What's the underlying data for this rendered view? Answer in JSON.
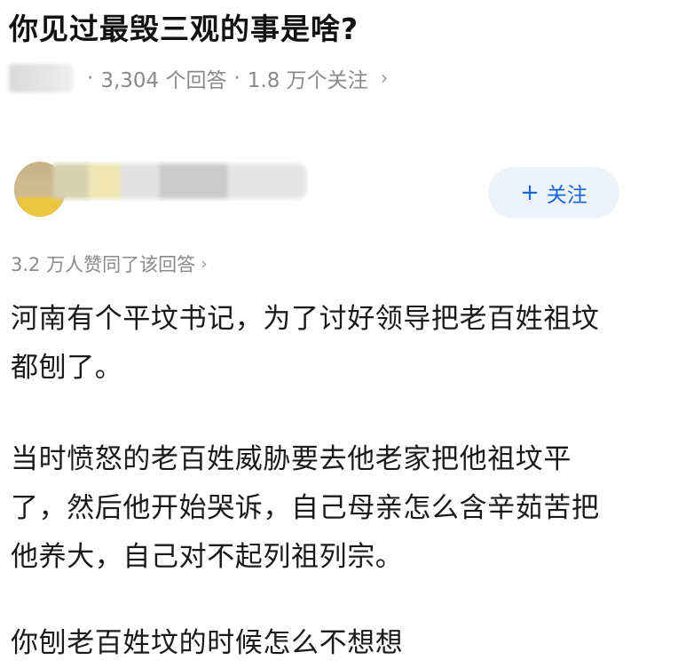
{
  "question": {
    "title": "你见过最毁三观的事是啥?",
    "meta": {
      "answers": "3,304 个回答",
      "followers": "1.8 万个关注",
      "separator": "·"
    }
  },
  "answer": {
    "follow_label": "关注",
    "likes_text": "3.2 万人赞同了该回答",
    "paragraphs": [
      {
        "lines": [
          "河南有个平坟书记，为了讨好领导把老百姓祖坟",
          "都刨了。"
        ]
      },
      {
        "lines": [
          "当时愤怒的老百姓威胁要去他老家把他祖坟平",
          "了，然后他开始哭诉，自己母亲怎么含辛茹苦把",
          "他养大，自己对不起列祖列宗。"
        ]
      },
      {
        "lines": [
          "你刨老百姓坟的时候怎么不想想"
        ]
      }
    ]
  },
  "icons": {
    "follow": "plus-icon",
    "more": "chevron-right-icon"
  },
  "colors": {
    "accent": "#1766d3",
    "follow_bg": "#eef3fb",
    "meta_text": "#8a8a8a"
  }
}
